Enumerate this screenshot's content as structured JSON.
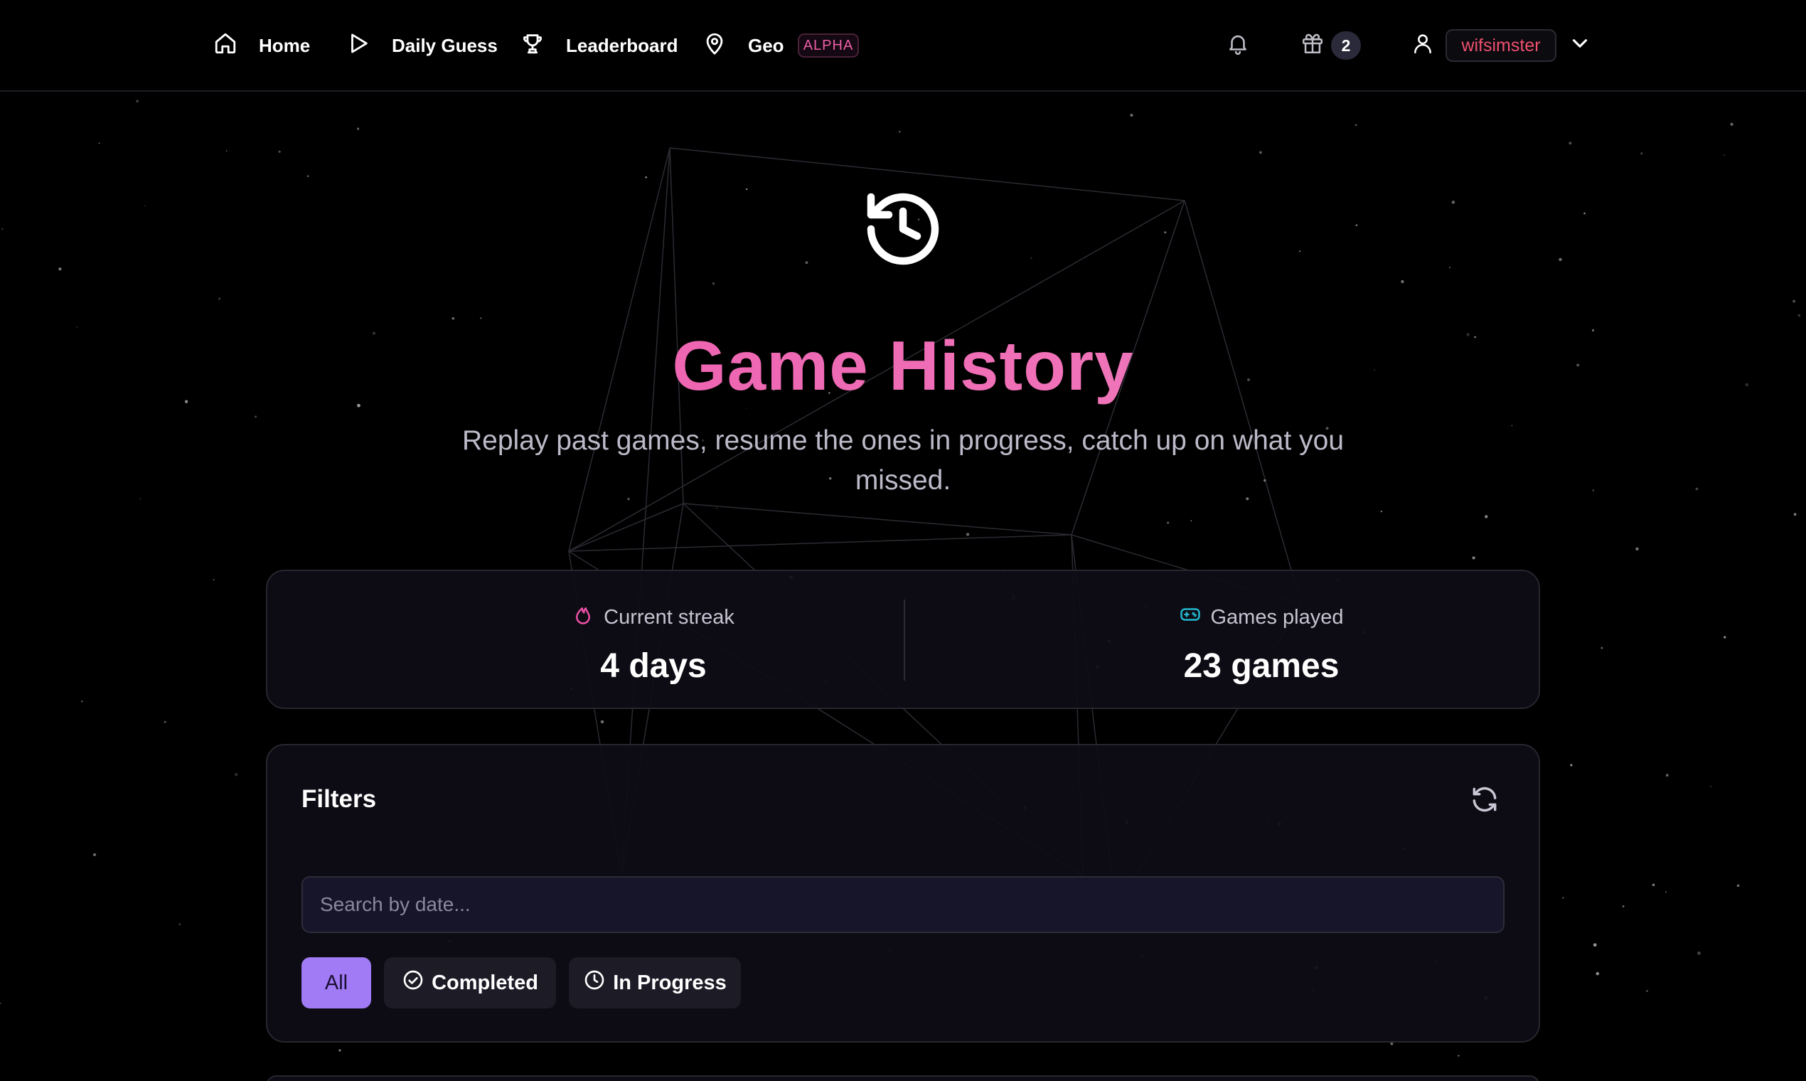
{
  "nav": {
    "items": [
      {
        "label": "Home",
        "icon": "home-icon"
      },
      {
        "label": "Daily Guess",
        "icon": "play-icon"
      },
      {
        "label": "Leaderboard",
        "icon": "trophy-icon"
      },
      {
        "label": "Geo",
        "icon": "map-pin-icon"
      }
    ],
    "geo_badge": "ALPHA",
    "gift_count": "2",
    "username": "wifsimster"
  },
  "hero": {
    "icon": "history-icon",
    "title": "Game History",
    "subtitle": "Replay past games, resume the ones in progress, catch up on what you missed."
  },
  "stats": {
    "streak": {
      "label": "Current streak",
      "value": "4 days",
      "icon": "flame-icon"
    },
    "games": {
      "label": "Games played",
      "value": "23 games",
      "icon": "gamepad-icon"
    }
  },
  "filters": {
    "title": "Filters",
    "search_placeholder": "Search by date...",
    "buttons": [
      {
        "label": "All",
        "active": true
      },
      {
        "label": "Completed",
        "icon": "check-circle-icon"
      },
      {
        "label": "In Progress",
        "icon": "clock-icon"
      }
    ]
  },
  "colors": {
    "accent_pink": "#ec4fa6",
    "accent_purple": "#a07bf5",
    "username_red": "#f0506e",
    "gamepad_cyan": "#22b8cf"
  }
}
